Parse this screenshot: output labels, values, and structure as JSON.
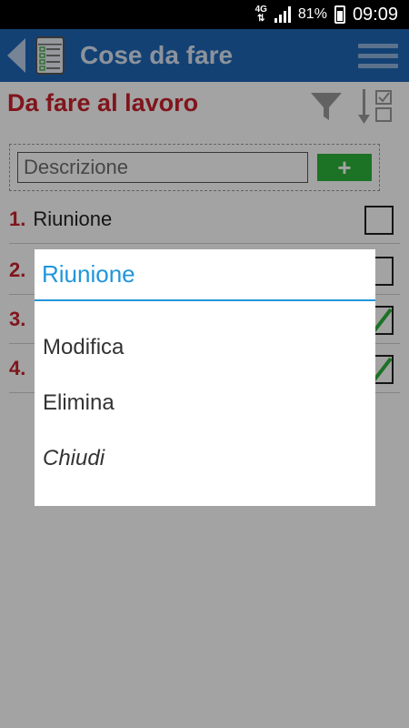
{
  "status_bar": {
    "network": "4G",
    "battery": "81%",
    "time": "09:09"
  },
  "action_bar": {
    "title": "Cose da fare",
    "icons": [
      "back-arrow-icon",
      "checklist-app-icon",
      "hamburger-menu-icon"
    ],
    "color": "#1f66b6"
  },
  "list": {
    "title": "Da fare al lavoro",
    "input_placeholder": "Descrizione",
    "add_label": "+",
    "items": [
      {
        "number": "1.",
        "text": "Riunione",
        "checked": false
      },
      {
        "number": "2.",
        "text": "",
        "checked": false
      },
      {
        "number": "3.",
        "text": "",
        "checked": true
      },
      {
        "number": "4.",
        "text": "",
        "checked": true
      }
    ]
  },
  "dialog": {
    "title": "Riunione",
    "options": [
      "Modifica",
      "Elimina",
      "Chiudi"
    ]
  },
  "colors": {
    "accent_red": "#c8222c",
    "add_green": "#2db33a",
    "dialog_blue": "#2196d9"
  }
}
